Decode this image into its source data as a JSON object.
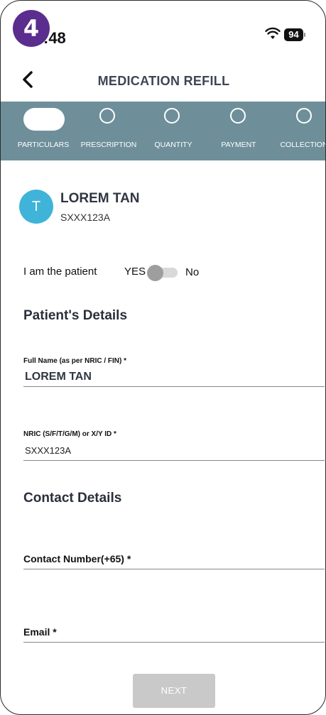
{
  "tutorial_badge": "4",
  "status_bar": {
    "time": ":48",
    "battery": "94"
  },
  "header": {
    "title": "MEDICATION REFILL"
  },
  "stepper": {
    "steps": [
      {
        "label": "PARTICULARS",
        "active": true
      },
      {
        "label": "PRESCRIPTION",
        "active": false
      },
      {
        "label": "QUANTITY",
        "active": false
      },
      {
        "label": "PAYMENT",
        "active": false
      },
      {
        "label": "COLLECTION",
        "active": false
      }
    ],
    "bar_color": "#6e8f9a"
  },
  "patient_card": {
    "avatar_initial": "T",
    "name": "LOREM TAN",
    "id": "SXXX123A",
    "avatar_color": "#3fb4d8"
  },
  "patient_toggle": {
    "label": "I am the patient",
    "yes": "YES",
    "no": "No",
    "is_patient": false
  },
  "patient_details": {
    "heading": "Patient's Details",
    "full_name_label": "Full Name (as per NRIC / FIN) *",
    "full_name_value": "LOREM TAN",
    "nric_label": "NRIC (S/F/T/G/M) or X/Y ID *",
    "nric_value": "SXXX123A"
  },
  "contact_details": {
    "heading": "Contact Details",
    "contact_label": "Contact Number(+65) *",
    "email_label": "Email *"
  },
  "footer": {
    "next_label": "NEXT"
  },
  "colors": {
    "badge": "#5b2d8e",
    "disabled_button": "#c9c9c9"
  }
}
